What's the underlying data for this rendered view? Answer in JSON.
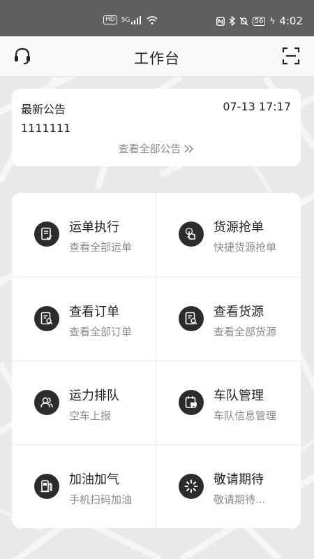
{
  "status_bar": {
    "hd": "HD",
    "network": "5G",
    "battery": "56",
    "time": "4:02"
  },
  "header": {
    "title": "工作台",
    "left_icon": "headset-icon",
    "right_icon": "scan-icon"
  },
  "notice": {
    "label": "最新公告",
    "time": "07-13 17:17",
    "content": "1111111",
    "more_label": "查看全部公告",
    "more_icon": "double-chevron-right-icon"
  },
  "grid": [
    {
      "title": "运单执行",
      "subtitle": "查看全部运单",
      "icon": "waybill-icon"
    },
    {
      "title": "货源抢单",
      "subtitle": "快捷货源抢单",
      "icon": "tap-hand-icon"
    },
    {
      "title": "查看订单",
      "subtitle": "查看全部订单",
      "icon": "order-search-icon"
    },
    {
      "title": "查看货源",
      "subtitle": "查看全部货源",
      "icon": "cargo-search-icon"
    },
    {
      "title": "运力排队",
      "subtitle": "空车上报",
      "icon": "people-queue-icon"
    },
    {
      "title": "车队管理",
      "subtitle": "车队信息管理",
      "icon": "fleet-truck-icon"
    },
    {
      "title": "加油加气",
      "subtitle": "手机扫码加油",
      "icon": "fuel-pump-icon"
    },
    {
      "title": "敬请期待",
      "subtitle": "敬请期待...",
      "icon": "loading-spinner-icon"
    }
  ],
  "colors": {
    "status_bar_bg": "#5f5f5f",
    "page_bg": "#ececec",
    "icon_bg": "#2c2c2c",
    "subtitle": "#8a8a8a"
  }
}
